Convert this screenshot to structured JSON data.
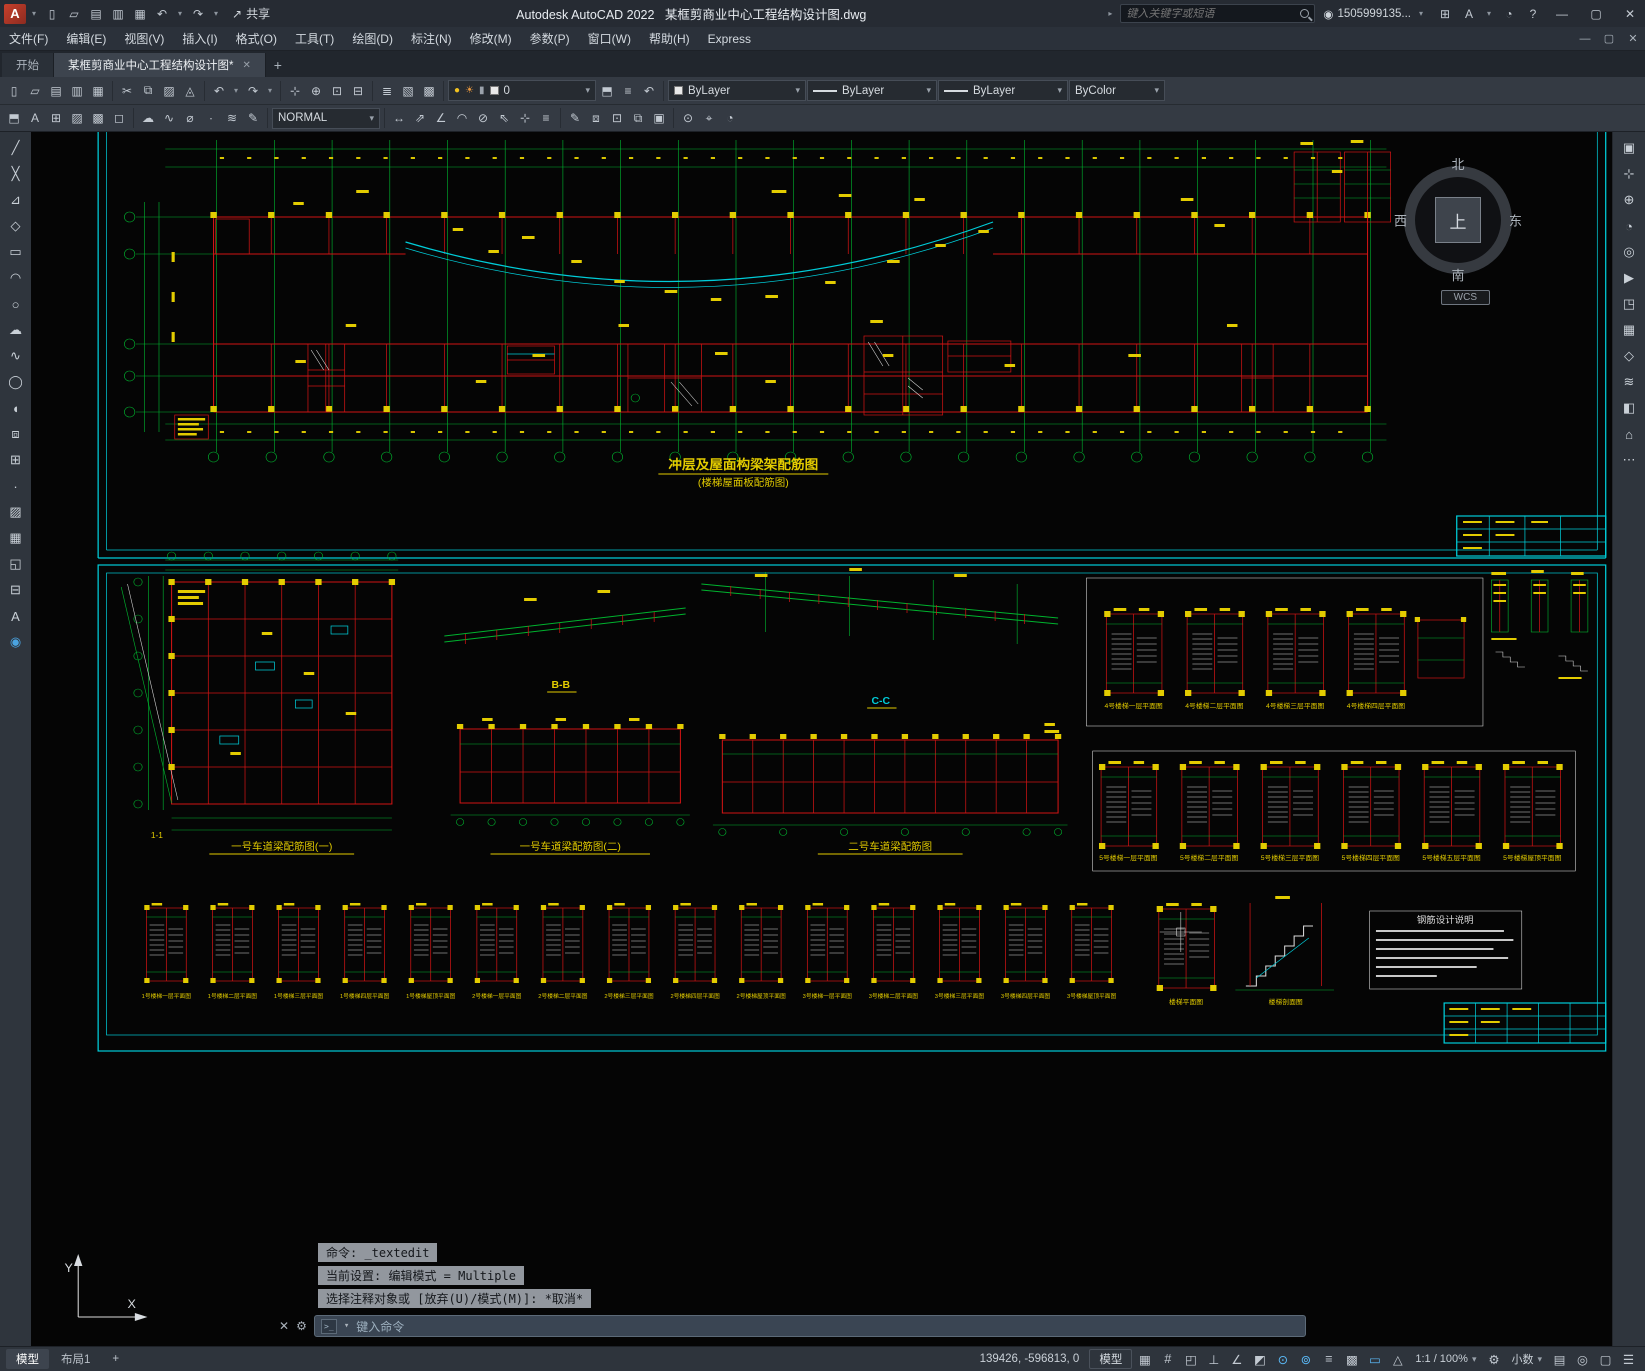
{
  "titlebar": {
    "app_title": "Autodesk AutoCAD 2022",
    "doc_title": "某框剪商业中心工程结构设计图.dwg",
    "share_label": "共享",
    "search_placeholder": "键入关键字或短语",
    "user_id": "1505999135..."
  },
  "menubar": {
    "items": [
      "文件(F)",
      "编辑(E)",
      "视图(V)",
      "插入(I)",
      "格式(O)",
      "工具(T)",
      "绘图(D)",
      "标注(N)",
      "修改(M)",
      "参数(P)",
      "窗口(W)",
      "帮助(H)",
      "Express"
    ]
  },
  "doc_tabs": {
    "start": "开始",
    "active": "某框剪商业中心工程结构设计图*",
    "close": "✕",
    "add": "+"
  },
  "toolbar": {
    "layer_value": "0",
    "color_value": "ByLayer",
    "linetype_value": "ByLayer",
    "lineweight_value": "ByLayer",
    "plotstyle_value": "ByColor",
    "text_style": "NORMAL"
  },
  "viewcube": {
    "north": "北",
    "south": "南",
    "west": "西",
    "east": "东",
    "up": "上",
    "wcs": "WCS"
  },
  "drawing": {
    "main_title": "冲层及屋面构梁架配筋图",
    "main_subtitle": "(楼梯屋面板配筋图)",
    "lane1_label": "一号车道梁配筋图(一)",
    "lane2_label": "一号车道梁配筋图(二)",
    "lane3_label": "二号车道梁配筋图",
    "section_b": "B-B",
    "section_c": "C-C",
    "section_1": "1-1",
    "notes_title": "钢筋设计说明",
    "groupA_labels": [
      "4号楼梯一层平面图",
      "4号楼梯二层平面图",
      "4号楼梯三层平面图",
      "4号楼梯四层平面图"
    ],
    "groupB_labels": [
      "5号楼梯一层平面图",
      "5号楼梯二层平面图",
      "5号楼梯三层平面图",
      "5号楼梯四层平面图",
      "5号楼梯五层平面图",
      "5号楼梯屋顶平面图"
    ],
    "bottom_labels": [
      "1号楼梯一层平面图",
      "1号楼梯二层平面图",
      "1号楼梯三层平面图",
      "1号楼梯四层平面图",
      "1号楼梯屋顶平面图",
      "2号楼梯一层平面图",
      "2号楼梯二层平面图",
      "2号楼梯三层平面图",
      "2号楼梯四层平面图",
      "2号楼梯屋顶平面图",
      "3号楼梯一层平面图",
      "3号楼梯二层平面图",
      "3号楼梯三层平面图",
      "3号楼梯四层平面图",
      "3号楼梯屋顶平面图"
    ],
    "mid_labels": [
      "楼梯平面图",
      "楼梯剖面图"
    ]
  },
  "command": {
    "line1": "命令: _textedit",
    "line2": "当前设置: 编辑模式 = Multiple",
    "line3": "选择注释对象或 [放弃(U)/模式(M)]: *取消*",
    "prompt": "键入命令",
    "badge": ">_"
  },
  "statusbar": {
    "model_tab": "模型",
    "layout_tab": "布局1",
    "add_tab": "+",
    "coords": "139426, -596813, 0",
    "model_space": "模型",
    "scale": "1:1 / 100%",
    "units": "小数"
  },
  "icons": {
    "caret": "▾",
    "app_logo": "A",
    "share": "↗",
    "user": "◉",
    "cart": "⊞",
    "autodesk": "A",
    "bell": "◔",
    "help": "?",
    "win_min": "—",
    "win_max": "▢",
    "win_close": "✕",
    "qat": [
      "▯",
      "▱",
      "▤",
      "▥",
      "▦",
      "↶",
      "↷"
    ],
    "t1": [
      "▯",
      "▱",
      "▤",
      "▥",
      "▦",
      "✂",
      "⧉",
      "▨",
      "◬",
      "↶",
      "↷",
      "⊹",
      "⊕",
      "⊡",
      "⊟",
      "≣",
      "▧",
      "▩"
    ],
    "layer_bulb": "●",
    "layer_sun": "☀",
    "layer_lock": "▮",
    "t2a": [
      "⬒",
      "A",
      "⊞",
      "▨",
      "▩",
      "◻",
      "☁",
      "∿",
      "⌀",
      "∙",
      "≋",
      "✎"
    ],
    "t2b": [
      "↔",
      "⇗",
      "∠",
      "◠",
      "⊘",
      "⇖",
      "⊹",
      "≡",
      "✎",
      "⧈",
      "⊡",
      "⧉",
      "▣",
      "⊙",
      "⌖",
      "◔"
    ],
    "left": [
      "╱",
      "╳",
      "⊿",
      "◇",
      "▭",
      "◠",
      "○",
      "☁",
      "∿",
      "◯",
      "◖",
      "⧈",
      "⊞",
      "·",
      "▨",
      "▦",
      "◱",
      "⊟",
      "A",
      "◉"
    ],
    "right": [
      "▣",
      "⊹",
      "⊕",
      "◔",
      "◎",
      "▶",
      "◳",
      "▦",
      "◇",
      "≋",
      "◧",
      "⌂",
      "⋯"
    ],
    "status": [
      "▦",
      "#",
      "◰",
      "⊥",
      "∠",
      "◩",
      "⊙",
      "⊚",
      "≡",
      "▩",
      "▭",
      "△"
    ],
    "status2": [
      "▤",
      "◎",
      "⚙",
      "▢",
      "☰"
    ],
    "cmd_close": "✕",
    "cmd_tools": "⚙"
  }
}
